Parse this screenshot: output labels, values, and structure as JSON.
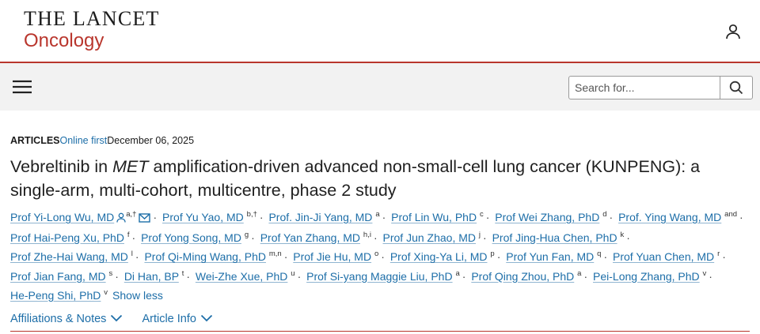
{
  "header": {
    "logo_top": "THE LANCET",
    "logo_bottom": "Oncology",
    "brand_color": "#b9362d",
    "user_icon": "user-icon"
  },
  "nav": {
    "menu_icon": "hamburger-menu-icon",
    "search_placeholder": "Search for...",
    "search_icon": "search-icon"
  },
  "article": {
    "type": "ARTICLES",
    "status": "Online first",
    "date": "December 06, 2025",
    "title_before": "Vebreltinib in ",
    "title_italic": "MET",
    "title_after": " amplification-driven advanced non-small-cell lung cancer (KUNPENG): a single-arm, multi-cohort, multicentre, phase 2 study"
  },
  "authors": [
    {
      "name": "Prof Yi-Long Wu, MD",
      "sup": "a,†"
    },
    {
      "name": "Prof Yu Yao, MD",
      "sup": "b,†"
    },
    {
      "name": "Prof. Jin-Ji Yang, MD",
      "sup": "a"
    },
    {
      "name": "Prof Lin Wu, PhD",
      "sup": "c"
    },
    {
      "name": "Prof Wei Zhang, PhD",
      "sup": "d"
    },
    {
      "name": "Prof. Ying Wang, MD",
      "sup": "and"
    },
    {
      "name": "Prof Hai-Peng Xu, PhD",
      "sup": "f"
    },
    {
      "name": "Prof Yong Song, MD",
      "sup": "g"
    },
    {
      "name": "Prof Yan Zhang, MD",
      "sup": "h,i"
    },
    {
      "name": "Prof Jun Zhao, MD",
      "sup": "j"
    },
    {
      "name": "Prof Jing-Hua Chen, PhD",
      "sup": "k"
    },
    {
      "name": "Prof Zhe-Hai Wang, MD",
      "sup": "l"
    },
    {
      "name": "Prof Qi-Ming Wang, PhD",
      "sup": "m,n"
    },
    {
      "name": "Prof Jie Hu, MD",
      "sup": "o"
    },
    {
      "name": "Prof Xing-Ya Li, MD",
      "sup": "p"
    },
    {
      "name": "Prof Yun Fan, MD",
      "sup": "q"
    },
    {
      "name": "Prof Yuan Chen, MD",
      "sup": "r"
    },
    {
      "name": "Prof Jian Fang, MD",
      "sup": "s"
    },
    {
      "name": "Di Han, BP",
      "sup": "t"
    },
    {
      "name": "Wei-Zhe Xue, PhD",
      "sup": "u"
    },
    {
      "name": "Prof Si-yang Maggie Liu, PhD",
      "sup": "a"
    },
    {
      "name": "Prof Qing Zhou, PhD",
      "sup": "a"
    },
    {
      "name": "Pei-Long Zhang, PhD",
      "sup": "v"
    },
    {
      "name": "He-Peng Shi, PhD",
      "sup": "v"
    }
  ],
  "author_separator": "·",
  "show_less": "Show less",
  "links": {
    "affiliations": "Affiliations & Notes",
    "article_info": "Article Info"
  }
}
